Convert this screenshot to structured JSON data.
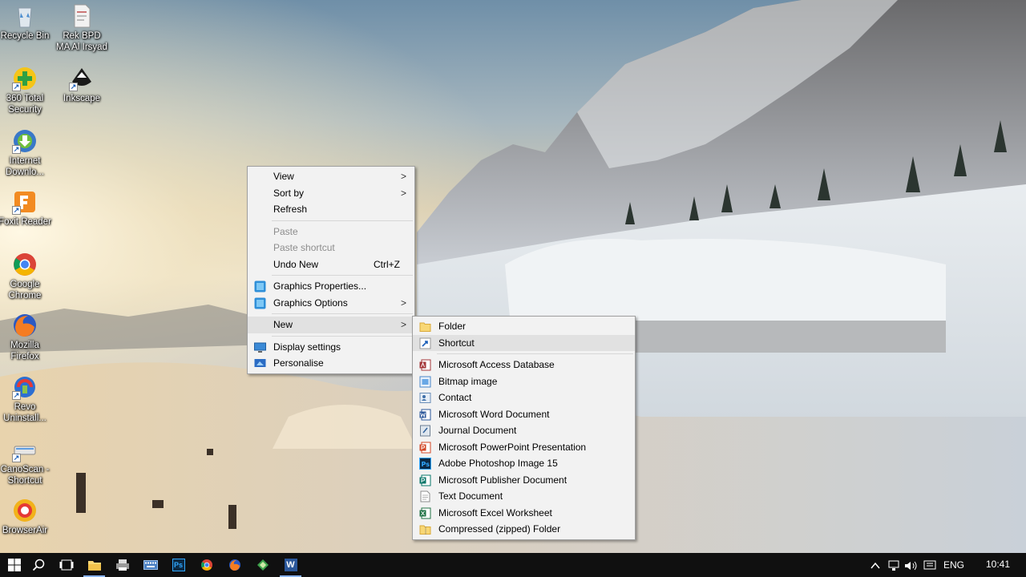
{
  "desktop_icons": [
    {
      "label": "Recycle Bin"
    },
    {
      "label": "Rek BPD MA Al Irsyad"
    },
    {
      "label": "360 Total Security"
    },
    {
      "label": "Inkscape"
    },
    {
      "label": "Internet Downlo..."
    },
    {
      "label": "Foxit Reader"
    },
    {
      "label": "Google Chrome"
    },
    {
      "label": "Mozilla Firefox"
    },
    {
      "label": "Revo Uninstall..."
    },
    {
      "label": "CanoScan - Shortcut"
    },
    {
      "label": "BrowserAir"
    }
  ],
  "context_menu": {
    "view": "View",
    "sort_by": "Sort by",
    "refresh": "Refresh",
    "paste": "Paste",
    "paste_shortcut": "Paste shortcut",
    "undo_new": "Undo New",
    "undo_shortcut": "Ctrl+Z",
    "graphics_properties": "Graphics Properties...",
    "graphics_options": "Graphics Options",
    "new": "New",
    "display_settings": "Display settings",
    "personalise": "Personalise",
    "submenu_arrow": ">"
  },
  "new_submenu": {
    "folder": "Folder",
    "shortcut": "Shortcut",
    "items": [
      {
        "label": "Microsoft Access Database",
        "icon": "access-icon"
      },
      {
        "label": "Bitmap image",
        "icon": "bitmap-icon"
      },
      {
        "label": "Contact",
        "icon": "contact-icon"
      },
      {
        "label": "Microsoft Word Document",
        "icon": "word-icon"
      },
      {
        "label": "Journal Document",
        "icon": "journal-icon"
      },
      {
        "label": "Microsoft PowerPoint Presentation",
        "icon": "powerpoint-icon"
      },
      {
        "label": "Adobe Photoshop Image 15",
        "icon": "photoshop-icon"
      },
      {
        "label": "Microsoft Publisher Document",
        "icon": "publisher-icon"
      },
      {
        "label": "Text Document",
        "icon": "text-icon"
      },
      {
        "label": "Microsoft Excel Worksheet",
        "icon": "excel-icon"
      },
      {
        "label": "Compressed (zipped) Folder",
        "icon": "zip-icon"
      }
    ]
  },
  "taskbar": {
    "language": "ENG",
    "time": "10:41",
    "ps_label": "Ps",
    "word_label": "W"
  },
  "colors": {
    "menu_bg": "#f2f2f2",
    "menu_hover": "#e1e1e1",
    "taskbar_bg": "#101010",
    "disabled_text": "#8d8d8d"
  }
}
